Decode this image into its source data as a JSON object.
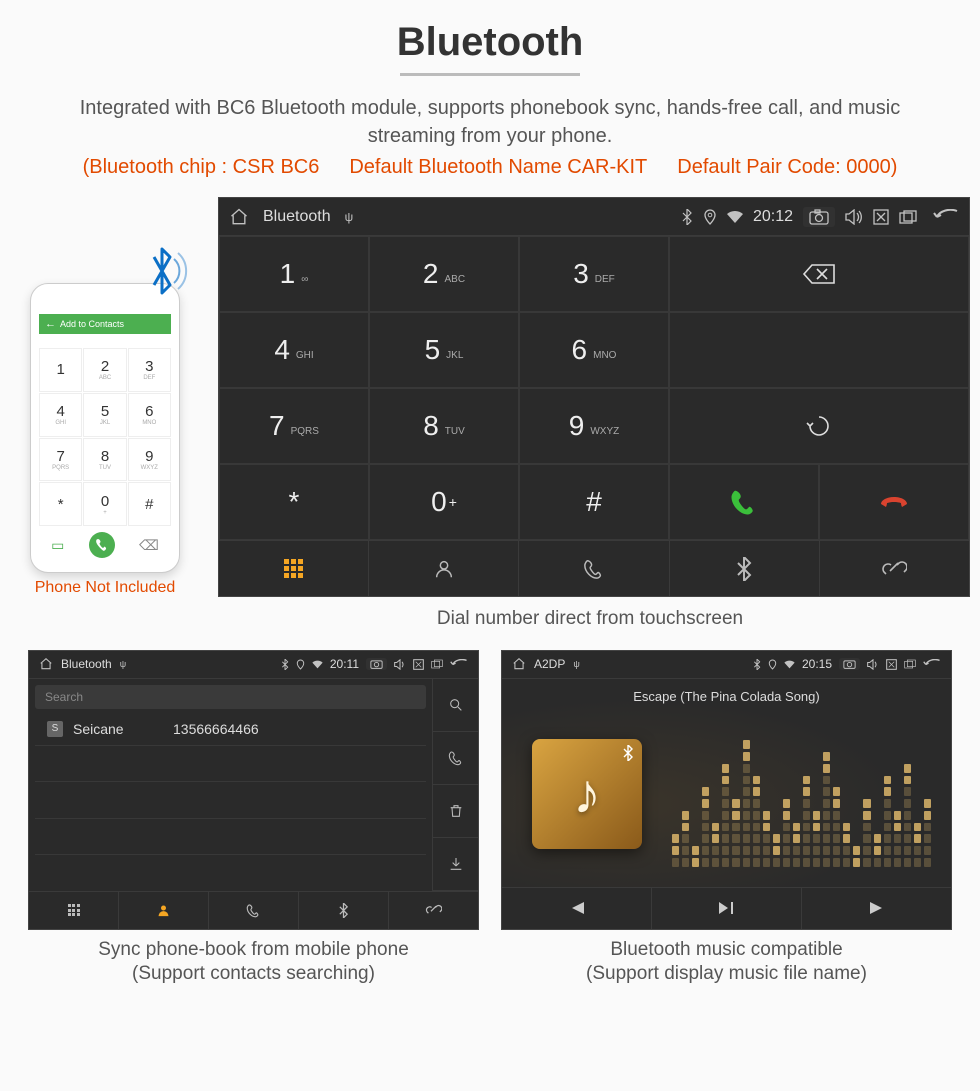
{
  "section": {
    "title": "Bluetooth",
    "intro": "Integrated with BC6 Bluetooth module, supports phonebook sync, hands-free call, and music streaming from your phone.",
    "spec_chip": "(Bluetooth chip : CSR BC6",
    "spec_name": "Default Bluetooth Name CAR-KIT",
    "spec_code": "Default Pair Code: 0000)"
  },
  "phone": {
    "header": "Add to Contacts",
    "caption": "Phone Not Included",
    "keys": [
      {
        "n": "1",
        "s": ""
      },
      {
        "n": "2",
        "s": "ABC"
      },
      {
        "n": "3",
        "s": "DEF"
      },
      {
        "n": "4",
        "s": "GHI"
      },
      {
        "n": "5",
        "s": "JKL"
      },
      {
        "n": "6",
        "s": "MNO"
      },
      {
        "n": "7",
        "s": "PQRS"
      },
      {
        "n": "8",
        "s": "TUV"
      },
      {
        "n": "9",
        "s": "WXYZ"
      },
      {
        "n": "*",
        "s": ""
      },
      {
        "n": "0",
        "s": "+"
      },
      {
        "n": "#",
        "s": ""
      }
    ]
  },
  "main_screen": {
    "status_title": "Bluetooth",
    "time": "20:12",
    "keys": [
      {
        "d": "1",
        "l": "∞"
      },
      {
        "d": "2",
        "l": "ABC"
      },
      {
        "d": "3",
        "l": "DEF"
      },
      {
        "d": "4",
        "l": "GHI"
      },
      {
        "d": "5",
        "l": "JKL"
      },
      {
        "d": "6",
        "l": "MNO"
      },
      {
        "d": "7",
        "l": "PQRS"
      },
      {
        "d": "8",
        "l": "TUV"
      },
      {
        "d": "9",
        "l": "WXYZ"
      },
      {
        "d": "*",
        "l": ""
      },
      {
        "d": "0",
        "l": "+"
      },
      {
        "d": "#",
        "l": ""
      }
    ],
    "caption": "Dial number direct from touchscreen"
  },
  "contacts_screen": {
    "status_title": "Bluetooth",
    "time": "20:11",
    "search_placeholder": "Search",
    "contact_badge": "S",
    "contact_name": "Seicane",
    "contact_number": "13566664466",
    "caption_line1": "Sync phone-book from mobile phone",
    "caption_line2": "(Support contacts searching)"
  },
  "music_screen": {
    "status_title": "A2DP",
    "time": "20:15",
    "song": "Escape (The Pina Colada Song)",
    "caption_line1": "Bluetooth music compatible",
    "caption_line2": "(Support display music file name)"
  }
}
